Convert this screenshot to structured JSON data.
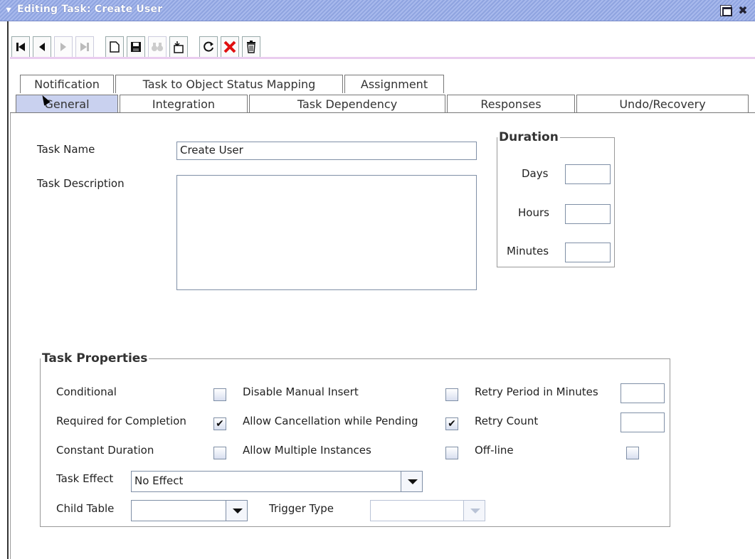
{
  "window": {
    "title": "Editing Task: Create User",
    "collapse_icon": "chevron-down-icon",
    "maximize_icon": "maximize-icon",
    "close_icon": "close-icon",
    "close_glyph": "✖"
  },
  "toolbar": {
    "first": {
      "icon": "first-record-icon",
      "glyph": "⏮"
    },
    "prev": {
      "icon": "previous-record-icon"
    },
    "next": {
      "icon": "next-record-icon"
    },
    "last": {
      "icon": "last-record-icon",
      "glyph": "⏭"
    },
    "new": {
      "icon": "new-document-icon",
      "glyph": "🗋"
    },
    "save": {
      "icon": "save-icon",
      "glyph": "💾"
    },
    "find": {
      "icon": "binoculars-icon",
      "glyph": "⚲"
    },
    "import": {
      "icon": "import-icon",
      "glyph": "⎘"
    },
    "refresh": {
      "icon": "refresh-icon",
      "glyph": "⟳"
    },
    "delete": {
      "icon": "delete-x-icon",
      "glyph": "✕"
    },
    "trash": {
      "icon": "trash-icon",
      "glyph": "🗑"
    }
  },
  "tabs_back": [
    {
      "label": "Notification"
    },
    {
      "label": "Task to Object Status Mapping"
    },
    {
      "label": "Assignment"
    }
  ],
  "tabs_front": [
    {
      "label": "General",
      "active": true
    },
    {
      "label": "Integration"
    },
    {
      "label": "Task Dependency"
    },
    {
      "label": "Responses"
    },
    {
      "label": "Undo/Recovery"
    }
  ],
  "general": {
    "task_name_label": "Task Name",
    "task_name_value": "Create User",
    "task_description_label": "Task Description",
    "task_description_value": ""
  },
  "duration": {
    "legend": "Duration",
    "days_label": "Days",
    "hours_label": "Hours",
    "minutes_label": "Minutes",
    "days_value": "",
    "hours_value": "",
    "minutes_value": ""
  },
  "task_properties": {
    "legend": "Task Properties",
    "conditional_label": "Conditional",
    "conditional_checked": false,
    "required_label": "Required for Completion",
    "required_checked": true,
    "constant_label": "Constant Duration",
    "constant_checked": false,
    "disable_manual_label": "Disable Manual Insert",
    "disable_manual_checked": false,
    "allow_cancel_label": "Allow Cancellation while Pending",
    "allow_cancel_checked": true,
    "allow_multiple_label": "Allow Multiple Instances",
    "allow_multiple_checked": false,
    "retry_period_label": "Retry Period in Minutes",
    "retry_period_value": "",
    "retry_count_label": "Retry Count",
    "retry_count_value": "",
    "offline_label": "Off-line",
    "offline_checked": false,
    "check_glyph": "✔",
    "task_effect_label": "Task Effect",
    "task_effect_value": "No Effect",
    "child_table_label": "Child Table",
    "child_table_value": "",
    "trigger_type_label": "Trigger Type",
    "trigger_type_value": ""
  },
  "colors": {
    "titlebar": "#8fa4e0",
    "active_tab": "#c9d1ef",
    "toolbar_accent": "#e9cdef",
    "delete_red": "#e01010"
  }
}
